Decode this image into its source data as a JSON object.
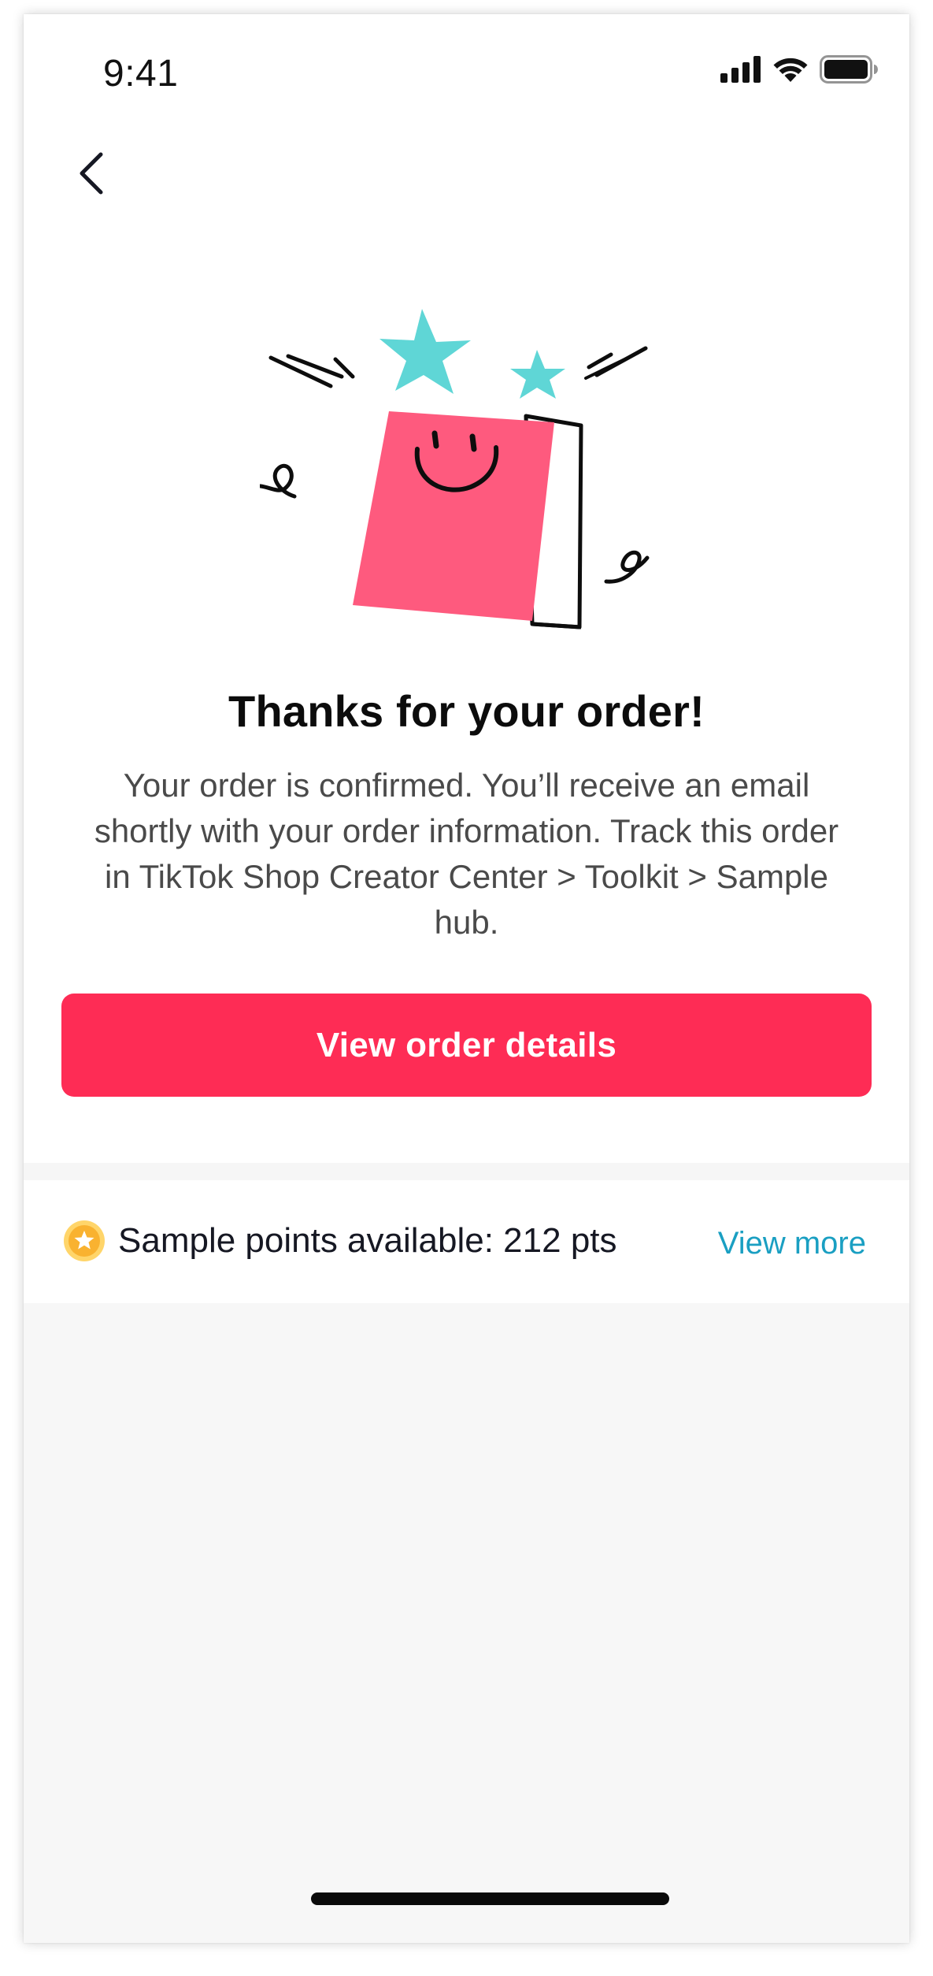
{
  "status_bar": {
    "time": "9:41",
    "icons": [
      "signal-icon",
      "wifi-icon",
      "battery-icon"
    ]
  },
  "nav": {
    "back_icon": "chevron-left-icon"
  },
  "illustration": {
    "icon": "happy-book-stars-illustration",
    "colors": {
      "book": "#fe5a7e",
      "stars": "#5fd6d6",
      "outline": "#0d0d0d"
    }
  },
  "confirmation": {
    "title": "Thanks for your order!",
    "message": "Your order is confirmed. You’ll receive an email shortly with your order information. Track this order in TikTok Shop Creator Center > Toolkit > Sample hub."
  },
  "primary_action": {
    "label": "View order details",
    "color": "#fe2c55"
  },
  "points": {
    "icon": "coin-star-icon",
    "label": "Sample points available: 212 pts",
    "link_label": "View more",
    "link_color": "#1a9fc2"
  }
}
